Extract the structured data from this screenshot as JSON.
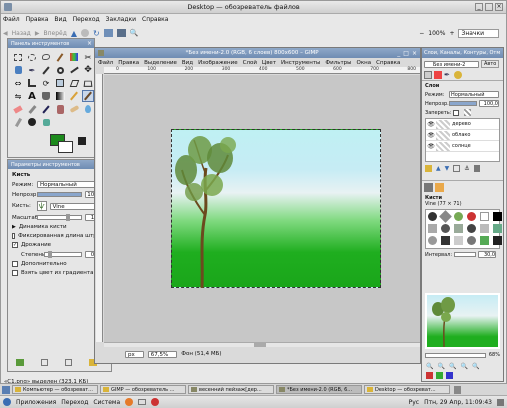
{
  "file_manager": {
    "title": "Desktop — обозреватель файлов",
    "menu": [
      "Файл",
      "Правка",
      "Вид",
      "Переход",
      "Закладки",
      "Справка"
    ],
    "back_label": "Назад",
    "forward_label": "Вперёд",
    "zoom": "100%",
    "view_mode": "Значки",
    "status": "«C1.png» выделен (323,1 КБ)"
  },
  "toolbox": {
    "title": "Панель инструментов"
  },
  "tool_options": {
    "title": "Параметры инструментов",
    "section": "Кисть",
    "mode_label": "Режим:",
    "mode_value": "Нормальный",
    "opacity_label": "Непрозр.",
    "opacity_value": "100,0",
    "brush_label": "Кисть:",
    "brush_value": "Vine",
    "scale_label": "Масштаб:",
    "scale_value": "1,54",
    "dynamics_label": "Динамика кисти",
    "fixed_length_label": "Фиксированная длина штриха",
    "jitter_label": "Дрожание",
    "jitter_checked": true,
    "amount_label": "Степень:",
    "amount_value": "0,16",
    "incremental_label": "Дополнительно",
    "gradient_label": "Взять цвет из градиента"
  },
  "gimp": {
    "title": "*Без имени-2.0 (RGB, 6 слоев) 800x600 – GIMP",
    "menu": [
      "Файл",
      "Правка",
      "Выделение",
      "Вид",
      "Изображение",
      "Слой",
      "Цвет",
      "Инструменты",
      "Фильтры",
      "Окна",
      "Справка"
    ],
    "ruler_labels": [
      "0",
      "100",
      "200",
      "300",
      "400",
      "500",
      "600",
      "700",
      "800"
    ],
    "unit": "px",
    "zoom": "67,5%",
    "status": "Фон (51,4 МБ)"
  },
  "layers_dock": {
    "title": "Слои, Каналы, Контуры, Отм",
    "image_select": "Без имени-2",
    "auto_label": "Авто",
    "section": "Слои",
    "mode_label": "Режим:",
    "mode_value": "Нормальный",
    "opacity_label": "Непрозр.:",
    "opacity_value": "100,0",
    "lock_label": "Запереть:",
    "layers": [
      {
        "name": "дерево"
      },
      {
        "name": "облако"
      },
      {
        "name": "солнце"
      }
    ]
  },
  "brushes_dock": {
    "section": "Кисти",
    "brush_info": "Vine (77 × 71)",
    "spacing_label": "Интервал:",
    "spacing_value": "30,0"
  },
  "navigation": {
    "zoom_value": "68%"
  },
  "taskbar": {
    "tasks": [
      "Компьютер — обозреват...",
      "GIMP — обозреватель ...",
      "весенний пейзаж[дер...",
      "*Без имени-2.0 (RGB, 6...",
      "Desktop — обозреват..."
    ],
    "menu_apps": "Приложения",
    "menu_places": "Переход",
    "menu_system": "Система",
    "layout": "Рус",
    "clock": "Птн, 29 Апр, 11:09:43"
  },
  "colors": {
    "title_bar": "#d9d9d9",
    "sky_top": "#bff0f3",
    "grass": "#1fae1f",
    "selection": "#3d6fb4"
  }
}
